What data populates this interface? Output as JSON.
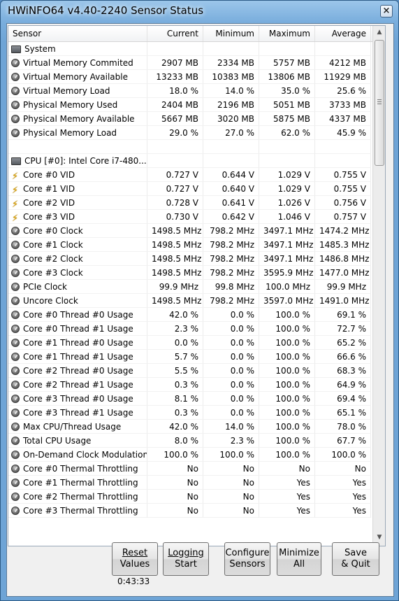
{
  "window": {
    "title": "HWiNFO64 v4.40-2240 Sensor Status",
    "close_label": "×"
  },
  "columns": {
    "sensor": "Sensor",
    "current": "Current",
    "minimum": "Minimum",
    "maximum": "Maximum",
    "average": "Average"
  },
  "rows": [
    {
      "icon": "chip",
      "name": "System",
      "group": true
    },
    {
      "icon": "gauge",
      "name": "Virtual Memory Commited",
      "current": "2907 MB",
      "minimum": "2334 MB",
      "maximum": "5757 MB",
      "average": "4212 MB"
    },
    {
      "icon": "gauge",
      "name": "Virtual Memory Available",
      "current": "13233 MB",
      "minimum": "10383 MB",
      "maximum": "13806 MB",
      "average": "11929 MB"
    },
    {
      "icon": "gauge",
      "name": "Virtual Memory Load",
      "current": "18.0 %",
      "minimum": "14.0 %",
      "maximum": "35.0 %",
      "average": "25.6 %"
    },
    {
      "icon": "gauge",
      "name": "Physical Memory Used",
      "current": "2404 MB",
      "minimum": "2196 MB",
      "maximum": "5051 MB",
      "average": "3733 MB"
    },
    {
      "icon": "gauge",
      "name": "Physical Memory Available",
      "current": "5667 MB",
      "minimum": "3020 MB",
      "maximum": "5875 MB",
      "average": "4337 MB"
    },
    {
      "icon": "gauge",
      "name": "Physical Memory Load",
      "current": "29.0 %",
      "minimum": "27.0 %",
      "maximum": "62.0 %",
      "average": "45.9 %"
    },
    {
      "icon": "none",
      "name": "",
      "blank": true
    },
    {
      "icon": "chip",
      "name": "CPU [#0]: Intel Core i7-480...",
      "group": true
    },
    {
      "icon": "bolt",
      "name": "Core #0 VID",
      "current": "0.727 V",
      "minimum": "0.644 V",
      "maximum": "1.029 V",
      "average": "0.755 V"
    },
    {
      "icon": "bolt",
      "name": "Core #1 VID",
      "current": "0.727 V",
      "minimum": "0.640 V",
      "maximum": "1.029 V",
      "average": "0.755 V"
    },
    {
      "icon": "bolt",
      "name": "Core #2 VID",
      "current": "0.728 V",
      "minimum": "0.641 V",
      "maximum": "1.026 V",
      "average": "0.756 V"
    },
    {
      "icon": "bolt",
      "name": "Core #3 VID",
      "current": "0.730 V",
      "minimum": "0.642 V",
      "maximum": "1.046 V",
      "average": "0.757 V"
    },
    {
      "icon": "gauge",
      "name": "Core #0 Clock",
      "current": "1498.5 MHz",
      "minimum": "798.2 MHz",
      "maximum": "3497.1 MHz",
      "average": "1474.2 MHz"
    },
    {
      "icon": "gauge",
      "name": "Core #1 Clock",
      "current": "1498.5 MHz",
      "minimum": "798.2 MHz",
      "maximum": "3497.1 MHz",
      "average": "1485.3 MHz"
    },
    {
      "icon": "gauge",
      "name": "Core #2 Clock",
      "current": "1498.5 MHz",
      "minimum": "798.2 MHz",
      "maximum": "3497.1 MHz",
      "average": "1486.8 MHz"
    },
    {
      "icon": "gauge",
      "name": "Core #3 Clock",
      "current": "1498.5 MHz",
      "minimum": "798.2 MHz",
      "maximum": "3595.9 MHz",
      "average": "1477.0 MHz"
    },
    {
      "icon": "gauge",
      "name": "PCIe Clock",
      "current": "99.9 MHz",
      "minimum": "99.8 MHz",
      "maximum": "100.0 MHz",
      "average": "99.9 MHz"
    },
    {
      "icon": "gauge",
      "name": "Uncore Clock",
      "current": "1498.5 MHz",
      "minimum": "798.2 MHz",
      "maximum": "3597.0 MHz",
      "average": "1491.0 MHz"
    },
    {
      "icon": "gauge",
      "name": "Core #0 Thread #0 Usage",
      "current": "42.0 %",
      "minimum": "0.0 %",
      "maximum": "100.0 %",
      "average": "69.1 %"
    },
    {
      "icon": "gauge",
      "name": "Core #0 Thread #1 Usage",
      "current": "2.3 %",
      "minimum": "0.0 %",
      "maximum": "100.0 %",
      "average": "72.7 %"
    },
    {
      "icon": "gauge",
      "name": "Core #1 Thread #0 Usage",
      "current": "0.0 %",
      "minimum": "0.0 %",
      "maximum": "100.0 %",
      "average": "65.2 %"
    },
    {
      "icon": "gauge",
      "name": "Core #1 Thread #1 Usage",
      "current": "5.7 %",
      "minimum": "0.0 %",
      "maximum": "100.0 %",
      "average": "66.6 %"
    },
    {
      "icon": "gauge",
      "name": "Core #2 Thread #0 Usage",
      "current": "5.5 %",
      "minimum": "0.0 %",
      "maximum": "100.0 %",
      "average": "68.3 %"
    },
    {
      "icon": "gauge",
      "name": "Core #2 Thread #1 Usage",
      "current": "0.3 %",
      "minimum": "0.0 %",
      "maximum": "100.0 %",
      "average": "64.9 %"
    },
    {
      "icon": "gauge",
      "name": "Core #3 Thread #0 Usage",
      "current": "8.1 %",
      "minimum": "0.0 %",
      "maximum": "100.0 %",
      "average": "69.4 %"
    },
    {
      "icon": "gauge",
      "name": "Core #3 Thread #1 Usage",
      "current": "0.3 %",
      "minimum": "0.0 %",
      "maximum": "100.0 %",
      "average": "65.1 %"
    },
    {
      "icon": "gauge",
      "name": "Max CPU/Thread Usage",
      "current": "42.0 %",
      "minimum": "14.0 %",
      "maximum": "100.0 %",
      "average": "78.0 %"
    },
    {
      "icon": "gauge",
      "name": "Total CPU Usage",
      "current": "8.0 %",
      "minimum": "2.3 %",
      "maximum": "100.0 %",
      "average": "67.7 %"
    },
    {
      "icon": "gauge",
      "name": "On-Demand Clock Modulation",
      "current": "100.0 %",
      "minimum": "100.0 %",
      "maximum": "100.0 %",
      "average": "100.0 %"
    },
    {
      "icon": "gauge",
      "name": "Core #0 Thermal Throttling",
      "current": "No",
      "minimum": "No",
      "maximum": "No",
      "average": "No"
    },
    {
      "icon": "gauge",
      "name": "Core #1 Thermal Throttling",
      "current": "No",
      "minimum": "No",
      "maximum": "Yes",
      "average": "Yes"
    },
    {
      "icon": "gauge",
      "name": "Core #2 Thermal Throttling",
      "current": "No",
      "minimum": "No",
      "maximum": "Yes",
      "average": "Yes"
    },
    {
      "icon": "gauge",
      "name": "Core #3 Thermal Throttling",
      "current": "No",
      "minimum": "No",
      "maximum": "Yes",
      "average": "Yes"
    }
  ],
  "buttons": {
    "reset": {
      "line1": "Reset",
      "line2": "Values"
    },
    "logging": {
      "line1": "Logging",
      "line2": "Start"
    },
    "configure": {
      "line1": "Configure",
      "line2": "Sensors"
    },
    "minimize": {
      "line1": "Minimize",
      "line2": "All"
    },
    "save": {
      "line1": "Save",
      "line2": "& Quit"
    }
  },
  "timer": "0:43:33",
  "colors": {
    "titlebar": "#7aaedd",
    "client_bg": "#f0f0f0",
    "list_bg": "#ffffff",
    "bolt": "#e0a400"
  }
}
